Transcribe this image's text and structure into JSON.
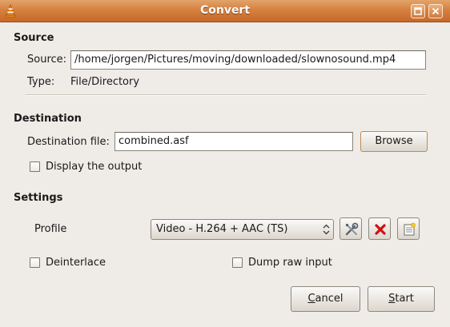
{
  "window": {
    "title": "Convert"
  },
  "source": {
    "heading": "Source",
    "source_label": "Source:",
    "source_value": "/home/jorgen/Pictures/moving/downloaded/slownosound.mp4",
    "type_label": "Type:",
    "type_value": "File/Directory"
  },
  "destination": {
    "heading": "Destination",
    "file_label": "Destination file:",
    "file_value": "combined.asf",
    "browse_label": "Browse",
    "display_output_label": "Display the output",
    "display_output_checked": false
  },
  "settings": {
    "heading": "Settings",
    "profile_label": "Profile",
    "profile_selected": "Video - H.264 + AAC (TS)",
    "deinterlace_label": "Deinterlace",
    "deinterlace_checked": false,
    "dump_raw_label": "Dump raw input",
    "dump_raw_checked": false
  },
  "actions": {
    "cancel_first": "C",
    "cancel_rest": "ancel",
    "start_first": "S",
    "start_rest": "tart"
  },
  "icons": {
    "app": "vlc-cone-icon",
    "maximize": "maximize-icon",
    "close": "close-icon",
    "edit_profile": "tools-icon",
    "delete_profile": "delete-x-icon",
    "new_profile": "new-profile-icon",
    "combo": "combo-arrows-icon"
  },
  "colors": {
    "titlebar": "#d6803f",
    "window_bg": "#efebe7",
    "delete_red": "#d01010"
  }
}
